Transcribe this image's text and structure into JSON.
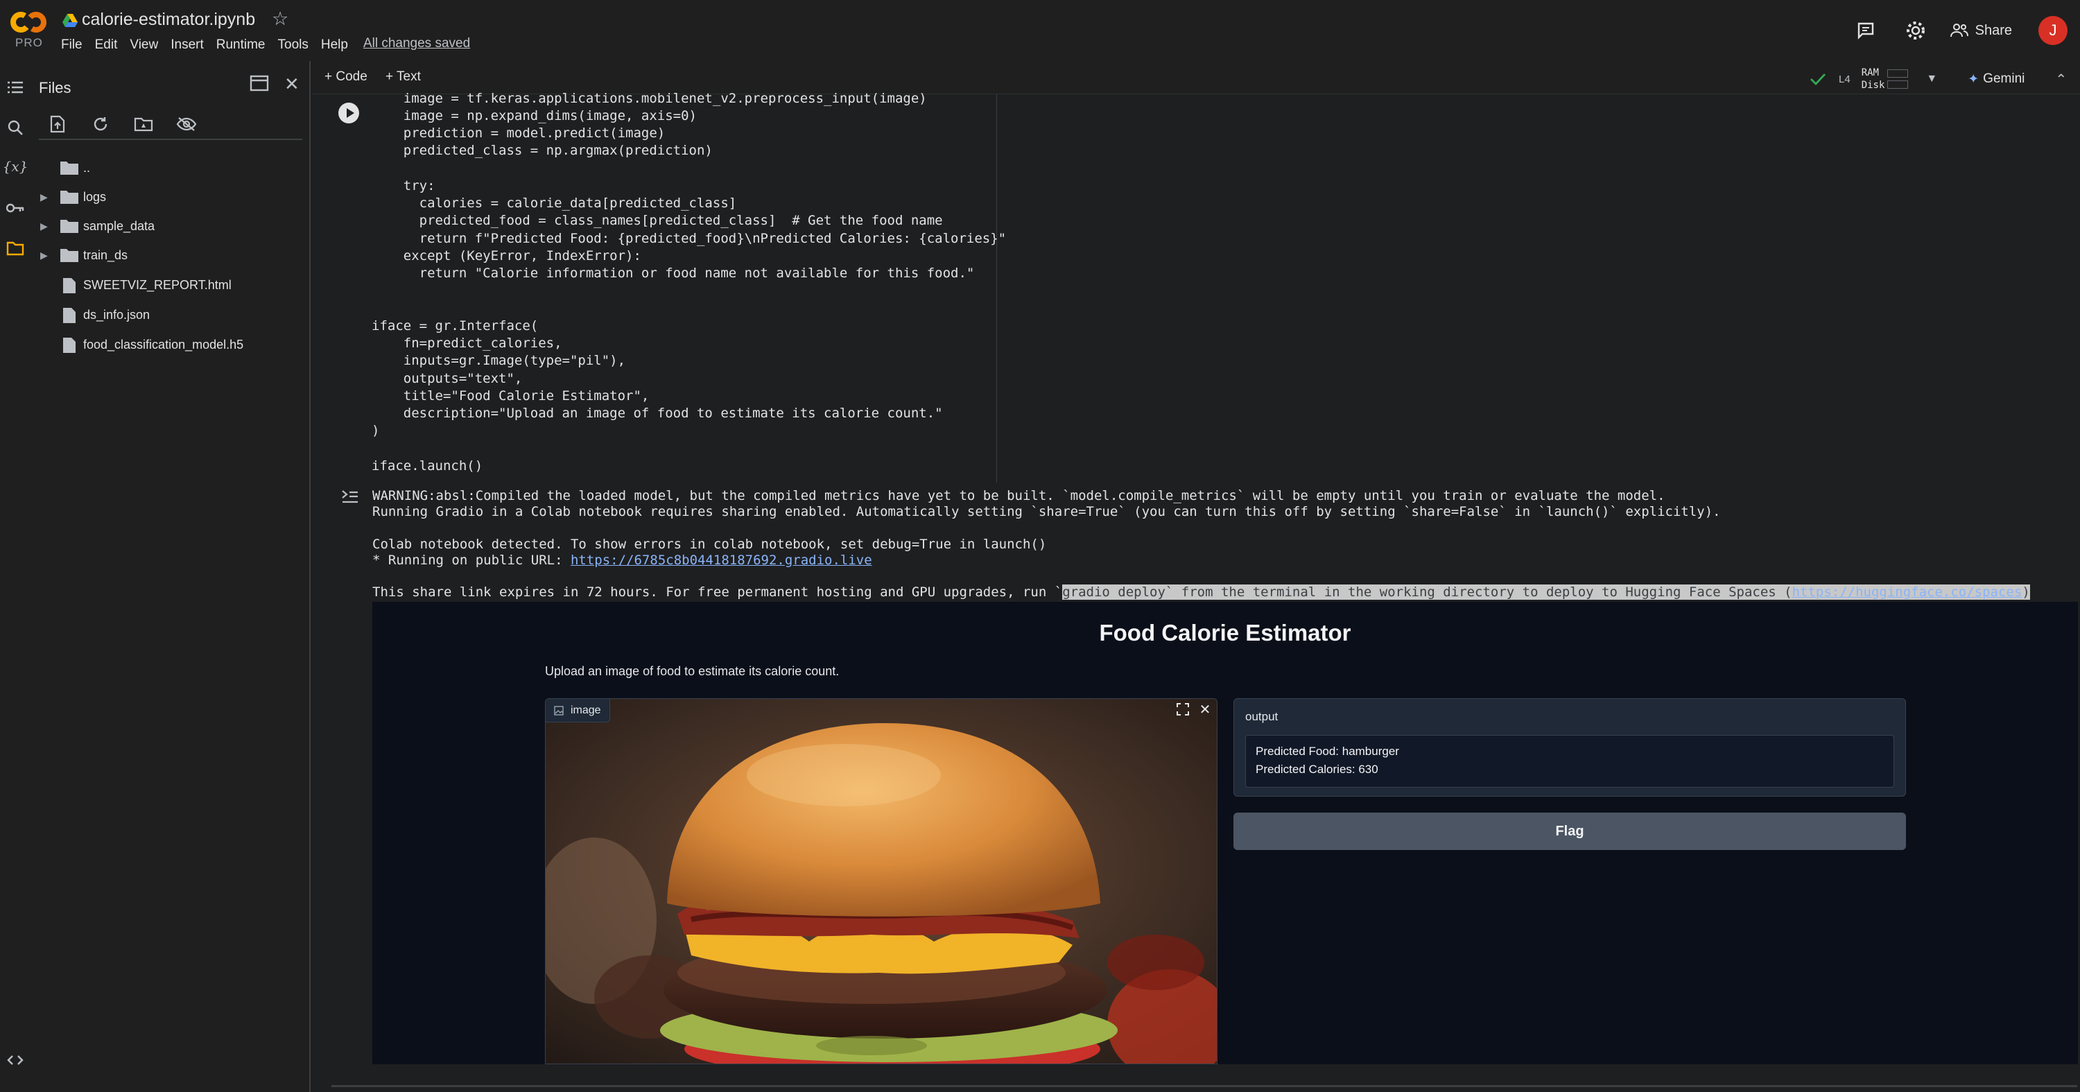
{
  "app": {
    "logo_badge": "PRO",
    "notebook_title": "calorie-estimator.ipynb",
    "save_status": "All changes saved"
  },
  "menu": [
    "File",
    "Edit",
    "View",
    "Insert",
    "Runtime",
    "Tools",
    "Help"
  ],
  "topbar": {
    "share_label": "Share",
    "avatar_initial": "J"
  },
  "files": {
    "title": "Files",
    "items": [
      {
        "type": "folder",
        "name": "..",
        "expandable": false
      },
      {
        "type": "folder",
        "name": "logs",
        "expandable": true
      },
      {
        "type": "folder",
        "name": "sample_data",
        "expandable": true
      },
      {
        "type": "folder",
        "name": "train_ds",
        "expandable": true
      },
      {
        "type": "file",
        "name": "SWEETVIZ_REPORT.html",
        "expandable": false
      },
      {
        "type": "file",
        "name": "ds_info.json",
        "expandable": false
      },
      {
        "type": "file",
        "name": "food_classification_model.h5",
        "expandable": false
      }
    ]
  },
  "notebook_toolbar": {
    "add_code": "+ Code",
    "add_text": "+ Text",
    "runtime_type": "L4",
    "ram_label": "RAM",
    "disk_label": "Disk",
    "gemini_label": "Gemini"
  },
  "code_cell": {
    "lines": [
      "    image = tf.keras.applications.mobilenet_v2.preprocess_input(image)",
      "    image = np.expand_dims(image, axis=0)",
      "    prediction = model.predict(image)",
      "    predicted_class = np.argmax(prediction)",
      "",
      "    try:",
      "      calories = calorie_data[predicted_class]",
      "      predicted_food = class_names[predicted_class]  # Get the food name",
      "      return f\"Predicted Food: {predicted_food}\\nPredicted Calories: {calories}\"",
      "    except (KeyError, IndexError):",
      "      return \"Calorie information or food name not available for this food.\"",
      "",
      "",
      "iface = gr.Interface(",
      "    fn=predict_calories,",
      "    inputs=gr.Image(type=\"pil\"),",
      "    outputs=\"text\",",
      "    title=\"Food Calorie Estimator\",",
      "    description=\"Upload an image of food to estimate its calorie count.\"",
      ")",
      "",
      "iface.launch()"
    ]
  },
  "output": {
    "warning": "WARNING:absl:Compiled the loaded model, but the compiled metrics have yet to be built. `model.compile_metrics` will be empty until you train or evaluate the model.",
    "sharing_note": "Running Gradio in a Colab notebook requires sharing enabled. Automatically setting `share=True` (you can turn this off by setting `share=False` in `launch()` explicitly).",
    "colab_detected": "Colab notebook detected. To show errors in colab notebook, set debug=True in launch()",
    "public_url_prefix": "* Running on public URL: ",
    "public_url": "https://6785c8b04418187692.gradio.live",
    "expires_prefix": "This share link expires in 72 hours. For free permanent hosting and GPU upgrades, run `",
    "expires_highlight": "gradio deploy` from the terminal in the working directory to deploy to Hugging Face Spaces (",
    "spaces_url": "https://huggingface.co/spaces",
    "expires_suffix": ")"
  },
  "gradio": {
    "title": "Food Calorie Estimator",
    "description": "Upload an image of food to estimate its calorie count.",
    "image_label": "image",
    "output_label": "output",
    "output_line_1": "Predicted Food: hamburger",
    "output_line_2": "Predicted Calories: 630",
    "flag_label": "Flag"
  },
  "colors": {
    "accent_blue": "#8ab4f8",
    "gradio_bg": "#0b0f19",
    "flag_button": "#4b5563",
    "avatar": "#d93025",
    "status_green": "#34a853"
  }
}
